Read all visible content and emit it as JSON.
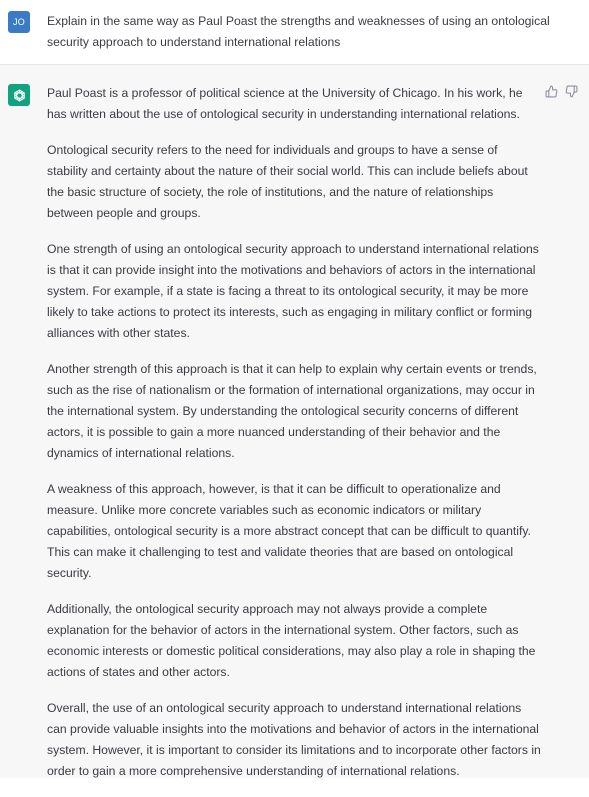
{
  "user_message": {
    "avatar_initials": "JO",
    "text": "Explain in the same way as Paul Poast the strengths and weaknesses of using an ontological security approach to understand international relations"
  },
  "assistant_message": {
    "avatar_icon": "openai-logo-icon",
    "paragraphs": [
      "Paul Poast is a professor of political science at the University of Chicago. In his work, he has written about the use of ontological security in understanding international relations.",
      "Ontological security refers to the need for individuals and groups to have a sense of stability and certainty about the nature of their social world. This can include beliefs about the basic structure of society, the role of institutions, and the nature of relationships between people and groups.",
      "One strength of using an ontological security approach to understand international relations is that it can provide insight into the motivations and behaviors of actors in the international system. For example, if a state is facing a threat to its ontological security, it may be more likely to take actions to protect its interests, such as engaging in military conflict or forming alliances with other states.",
      "Another strength of this approach is that it can help to explain why certain events or trends, such as the rise of nationalism or the formation of international organizations, may occur in the international system. By understanding the ontological security concerns of different actors, it is possible to gain a more nuanced understanding of their behavior and the dynamics of international relations.",
      "A weakness of this approach, however, is that it can be difficult to operationalize and measure. Unlike more concrete variables such as economic indicators or military capabilities, ontological security is a more abstract concept that can be difficult to quantify. This can make it challenging to test and validate theories that are based on ontological security.",
      "Additionally, the ontological security approach may not always provide a complete explanation for the behavior of actors in the international system. Other factors, such as economic interests or domestic political considerations, may also play a role in shaping the actions of states and other actors.",
      "Overall, the use of an ontological security approach to understand international relations can provide valuable insights into the motivations and behavior of actors in the international system. However, it is important to consider its limitations and to incorporate other factors in order to gain a more comprehensive understanding of international relations."
    ],
    "feedback_icons": [
      "thumbs-up-icon",
      "thumbs-down-icon"
    ]
  },
  "colors": {
    "user_avatar_bg": "#3b7ac4",
    "bot_avatar_bg": "#10a37f",
    "assistant_bg": "#f7f7f8",
    "text": "#3b3b42"
  }
}
